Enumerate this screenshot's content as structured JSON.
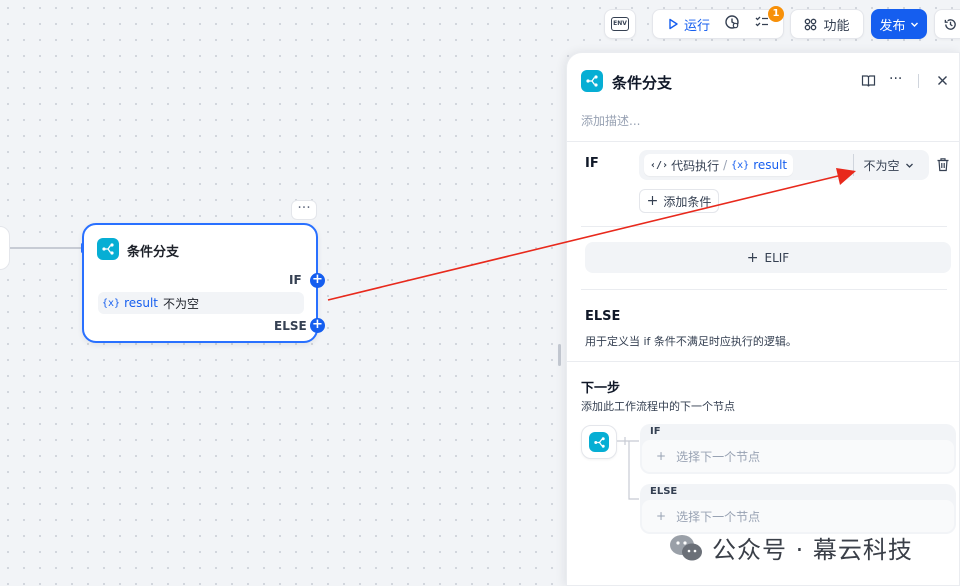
{
  "toolbar": {
    "env_label": "ENV",
    "run_label": "运行",
    "checklist_badge": "1",
    "features_label": "功能",
    "publish_label": "发布"
  },
  "node": {
    "title": "条件分支",
    "if_label": "IF",
    "else_label": "ELSE",
    "condition_var_icon": "{x}",
    "condition_var": "result",
    "condition_op": "不为空"
  },
  "panel": {
    "title": "条件分支",
    "description_placeholder": "添加描述...",
    "if_title": "IF",
    "condition": {
      "source_node": "代码执行",
      "separator": "/",
      "var_icon": "{x}",
      "var_name": "result",
      "operator": "不为空"
    },
    "add_condition_label": "添加条件",
    "elif_label": "ELIF",
    "else_title": "ELSE",
    "else_desc": "用于定义当 if 条件不满足时应执行的逻辑。",
    "next_title": "下一步",
    "next_desc": "添加此工作流程中的下一个节点",
    "branches": [
      {
        "label": "IF",
        "placeholder": "选择下一个节点"
      },
      {
        "label": "ELSE",
        "placeholder": "选择下一个节点"
      }
    ]
  },
  "watermark": {
    "text": "公众号 · 幕云科技"
  },
  "colors": {
    "accent": "#155eef",
    "node_icon": "#06aed4",
    "badge": "#f79009",
    "arrow": "#e8291c"
  }
}
